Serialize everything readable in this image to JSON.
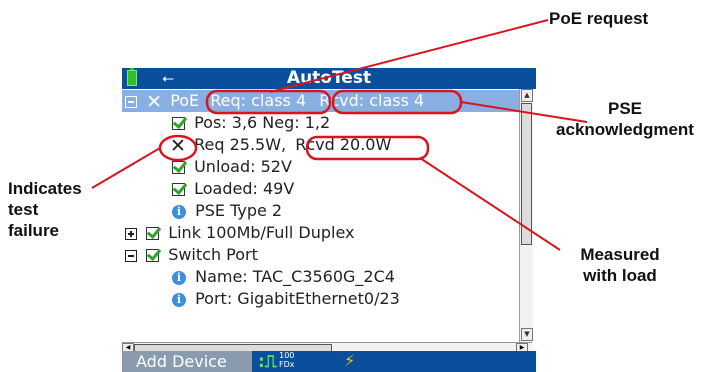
{
  "callouts": {
    "poe_request": "PoE request",
    "pse_ack_line1": "PSE",
    "pse_ack_line2": "acknowledgment",
    "test_failure_line1": "Indicates",
    "test_failure_line2": "test",
    "test_failure_line3": "failure",
    "measured_line1": "Measured",
    "measured_line2": "with load"
  },
  "device": {
    "title": "AutoTest",
    "rows": [
      {
        "label": "PoE",
        "extra1": "Req: class 4",
        "extra2": "Rcvd: class 4"
      },
      {
        "label": "Pos: 3,6 Neg: 1,2"
      },
      {
        "label": "Req 25.5W,",
        "extra1": "Rcvd 20.0W"
      },
      {
        "label": "Unload: 52V"
      },
      {
        "label": "Loaded: 49V"
      },
      {
        "label": "PSE Type 2"
      },
      {
        "label": "Link 100Mb/Full Duplex"
      },
      {
        "label": "Switch Port"
      },
      {
        "label": "Name: TAC_C3560G_2C4"
      },
      {
        "label": "Port: GigabitEthernet0/23"
      }
    ],
    "softkey": "Add Device",
    "speed_top": "100",
    "speed_bottom": "FDx"
  },
  "icons": {
    "battery": "battery-icon",
    "usb": "usb-icon",
    "fail": "x-mark-icon",
    "pass": "checkbox-checked-icon",
    "info": "info-icon",
    "link": "link-pulse-icon",
    "poe": "lightning-bolt-icon"
  },
  "colors": {
    "titlebar": "#0a4f9c",
    "selection": "#88aee2",
    "annotation": "#d9141f",
    "check": "#2ea32e",
    "info": "#3d8ee0",
    "bolt": "#f3c21d"
  }
}
